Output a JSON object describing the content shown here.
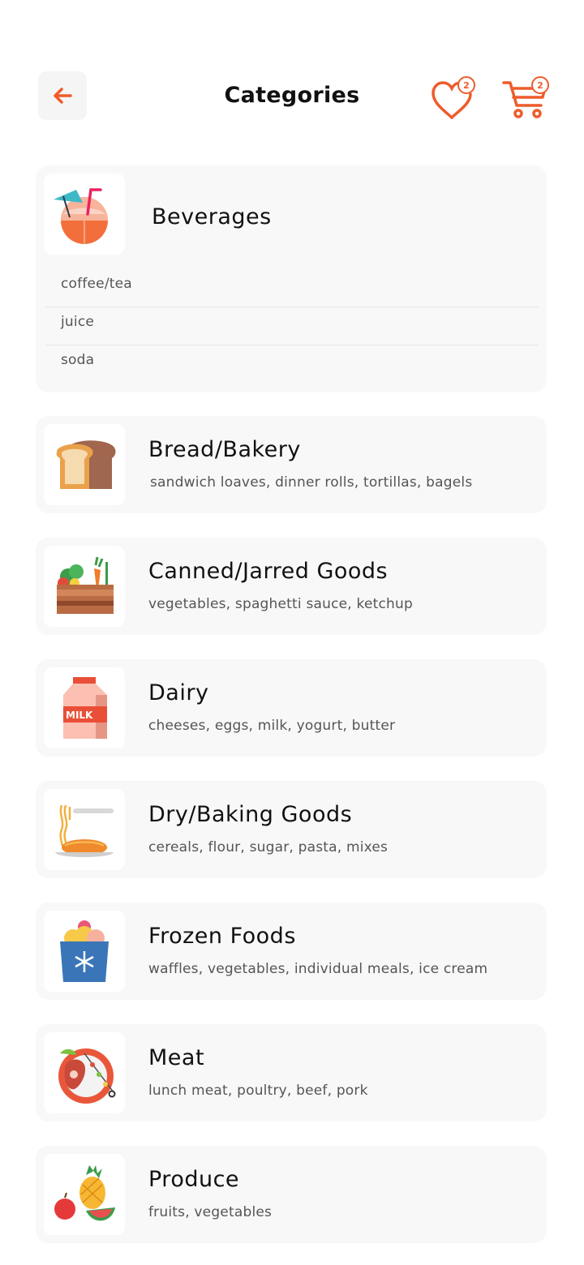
{
  "header": {
    "title": "Categories",
    "favorites_count": "2",
    "cart_count": "2",
    "accent_color": "#ee5c2c"
  },
  "beverages": {
    "title": "Beverages",
    "icon": "coconut-drink-icon",
    "items": [
      "coffee/tea",
      "juice",
      "soda"
    ]
  },
  "categories": [
    {
      "title": "Bread/Bakery",
      "subtitle": "sandwich loaves, dinner rolls, tortillas, bagels",
      "icon": "bread-icon"
    },
    {
      "title": "Canned/Jarred Goods",
      "subtitle": "vegetables, spaghetti sauce, ketchup",
      "icon": "vegetable-crate-icon"
    },
    {
      "title": "Dairy",
      "subtitle": "cheeses, eggs, milk, yogurt, butter",
      "icon": "milk-carton-icon"
    },
    {
      "title": "Dry/Baking Goods",
      "subtitle": "cereals, flour, sugar, pasta, mixes",
      "icon": "noodles-icon"
    },
    {
      "title": "Frozen Foods",
      "subtitle": "waffles, vegetables, individual meals, ice cream",
      "icon": "ice-cream-box-icon"
    },
    {
      "title": "Meat",
      "subtitle": "lunch meat, poultry, beef, pork",
      "icon": "steak-plate-icon"
    },
    {
      "title": "Produce",
      "subtitle": "fruits, vegetables",
      "icon": "fruits-icon"
    }
  ]
}
